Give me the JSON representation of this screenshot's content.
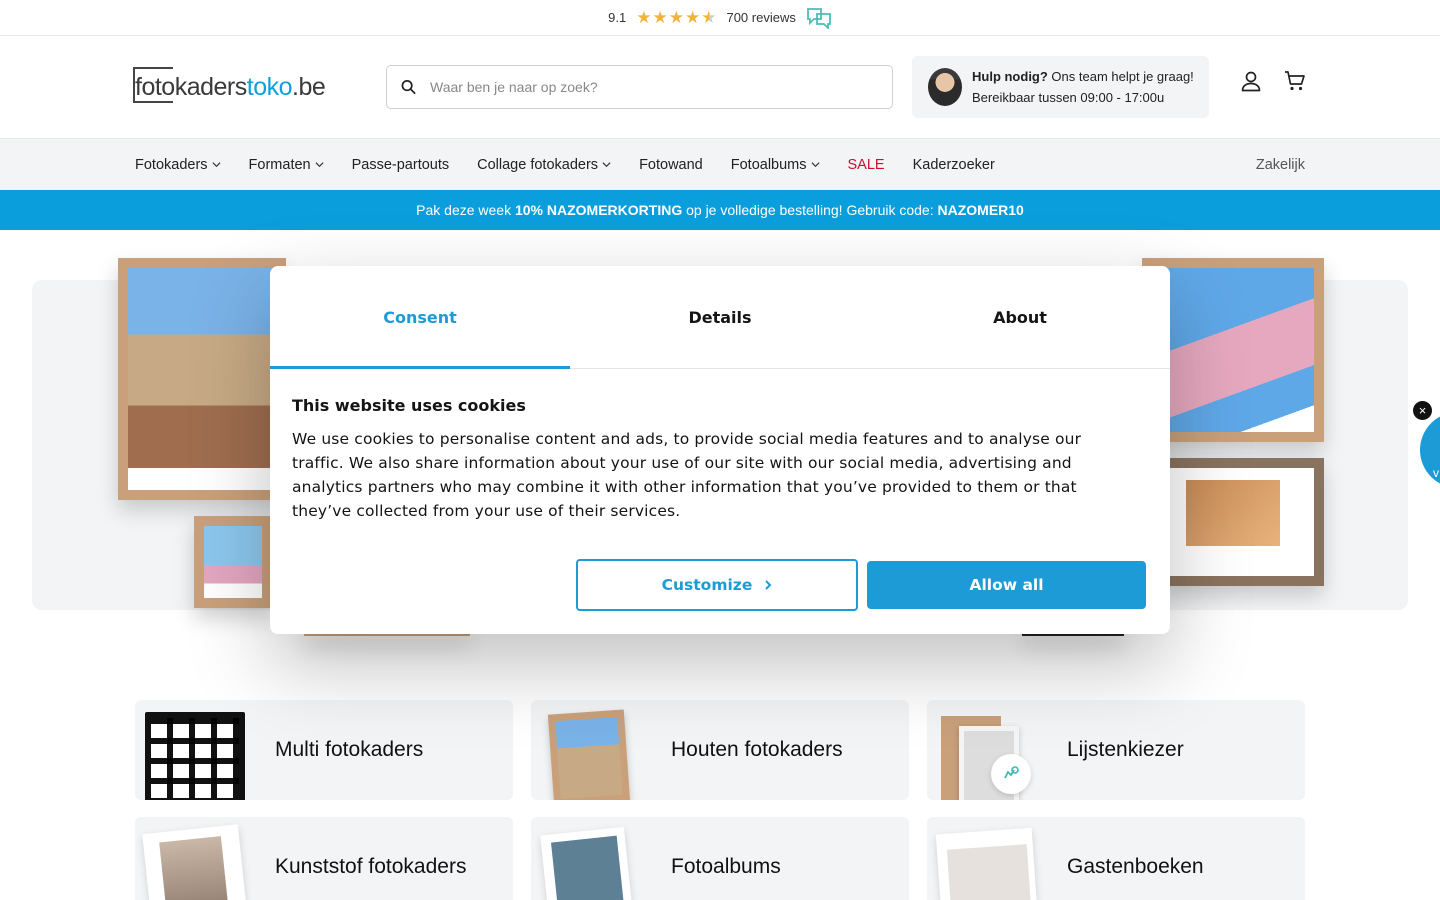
{
  "reviews": {
    "score": "9.1",
    "stars": 4.5,
    "count": "700 reviews",
    "star_color": "#f2b33d"
  },
  "header": {
    "logo_part1": "fotokaders",
    "logo_part2": "toko",
    "logo_part3": ".be",
    "search_placeholder": "Waar ben je naar op zoek?",
    "help_bold": "Hulp nodig?",
    "help_text": " Ons team helpt je graag!",
    "help_hours": "Bereikbaar tussen 09:00 - 17:00u",
    "icons": [
      "user-icon",
      "cart-icon"
    ]
  },
  "nav": {
    "items": [
      {
        "label": "Fotokaders",
        "dropdown": true
      },
      {
        "label": "Formaten",
        "dropdown": true
      },
      {
        "label": "Passe-partouts",
        "dropdown": false
      },
      {
        "label": "Collage fotokaders",
        "dropdown": true
      },
      {
        "label": "Fotowand",
        "dropdown": false
      },
      {
        "label": "Fotoalbums",
        "dropdown": true
      },
      {
        "label": "SALE",
        "dropdown": false
      },
      {
        "label": "Kaderzoeker",
        "dropdown": false
      }
    ],
    "right": "Zakelijk",
    "sale_color": "#c8102e"
  },
  "promo": {
    "pre": "Pak deze week ",
    "bold1": "10% NAZOMERKORTING",
    "mid": " op je volledige bestelling! Gebruik code: ",
    "bold2": "NAZOMER10",
    "bg_color": "#0a9fdc"
  },
  "categories": [
    {
      "label": "Multi fotokaders"
    },
    {
      "label": "Houten fotokaders"
    },
    {
      "label": "Lijstenkiezer"
    },
    {
      "label": "Kunststof fotokaders"
    },
    {
      "label": "Fotoalbums"
    },
    {
      "label": "Gastenboeken"
    }
  ],
  "cookie": {
    "tabs": [
      "Consent",
      "Details",
      "About"
    ],
    "active_tab": "Consent",
    "title": "This website uses cookies",
    "body": "We use cookies to personalise content and ads, to provide social media features and to analyse our traffic. We also share information about your use of our site with our social media, advertising and analytics partners who may combine it with other information that you’ve provided to them or that they’ve collected from your use of their services.",
    "customize_label": "Customize",
    "allow_label": "Allow all",
    "accent_color": "#1d9bd7"
  },
  "side_widget": {
    "close": "×",
    "text": "v"
  }
}
